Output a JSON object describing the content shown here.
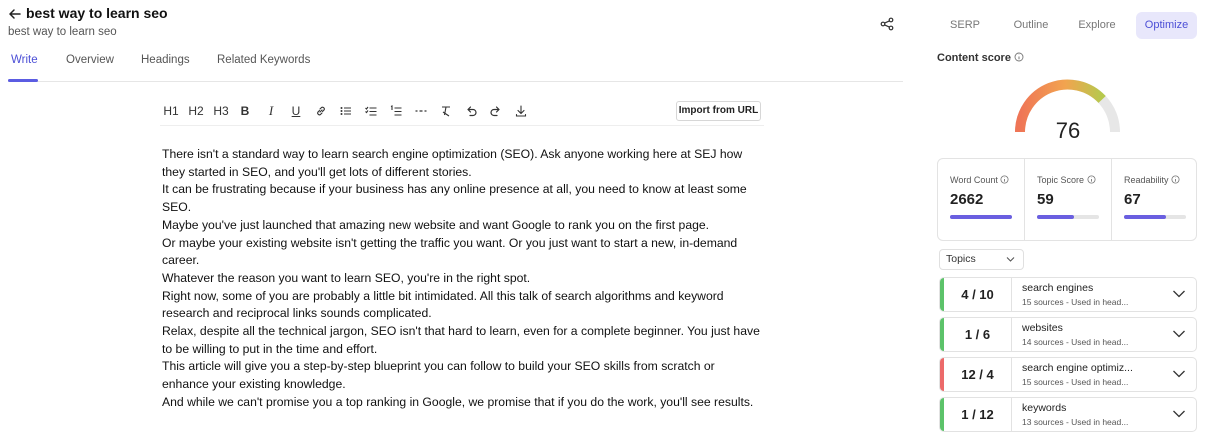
{
  "header": {
    "title": "best way to learn seo",
    "subtitle": "best way to learn seo"
  },
  "tabs": [
    {
      "label": "Write",
      "active": true
    },
    {
      "label": "Overview",
      "active": false
    },
    {
      "label": "Headings",
      "active": false
    },
    {
      "label": "Related Keywords",
      "active": false
    }
  ],
  "toolbar": {
    "h1": "H1",
    "h2": "H2",
    "h3": "H3",
    "bold": "B",
    "italic": "I",
    "underline": "U",
    "import_label": "Import from URL"
  },
  "content": {
    "paragraphs": [
      "There isn't a standard way to learn search engine optimization (SEO). Ask anyone working here at SEJ how they started in SEO, and you'll get lots of different stories.",
      "It can be frustrating because if your business has any online presence at all, you need to know at least some SEO.",
      "Maybe you've just launched that amazing new website and want Google to rank you on the first page.",
      "Or maybe your existing website isn't getting the traffic you want. Or you just want to start a new, in-demand career.",
      "Whatever the reason you want to learn SEO, you're in the right spot.",
      "Right now, some of you are probably a little bit intimidated. All this talk of search algorithms and keyword research and reciprocal links sounds complicated.",
      "Relax, despite all the technical jargon, SEO isn't that hard to learn, even for a complete beginner. You just have to be willing to put in the time and effort.",
      "This article will give you a step-by-step blueprint you can follow to build your SEO skills from scratch or enhance your existing knowledge.",
      "And while we can't promise you a top ranking in Google, we promise that if you do the work, you'll see results."
    ]
  },
  "right_tabs": [
    {
      "label": "SERP",
      "active": false
    },
    {
      "label": "Outline",
      "active": false
    },
    {
      "label": "Explore",
      "active": false
    },
    {
      "label": "Optimize",
      "active": true
    }
  ],
  "score": {
    "label": "Content score",
    "value": "76",
    "fraction": 0.76
  },
  "metrics": [
    {
      "label": "Word Count",
      "value": "2662",
      "fill": 1.0
    },
    {
      "label": "Topic Score",
      "value": "59",
      "fill": 0.59
    },
    {
      "label": "Readability",
      "value": "67",
      "fill": 0.67
    }
  ],
  "topics": {
    "dropdown_label": "Topics",
    "items": [
      {
        "count": "4 / 10",
        "name": "search engines",
        "sub": "15 sources - Used in head...",
        "status_color": "#5cc36a"
      },
      {
        "count": "1 / 6",
        "name": "websites",
        "sub": "14 sources - Used in head...",
        "status_color": "#5cc36a"
      },
      {
        "count": "12 / 4",
        "name": "search engine optimiz...",
        "sub": "15 sources - Used in head...",
        "status_color": "#ec6a6a"
      },
      {
        "count": "1 / 12",
        "name": "keywords",
        "sub": "13 sources - Used in head...",
        "status_color": "#5cc36a"
      }
    ]
  },
  "colors": {
    "accent": "#4c4fd6",
    "bar": "#6a5fe0",
    "active_tab_bg": "#e8e7fb"
  }
}
